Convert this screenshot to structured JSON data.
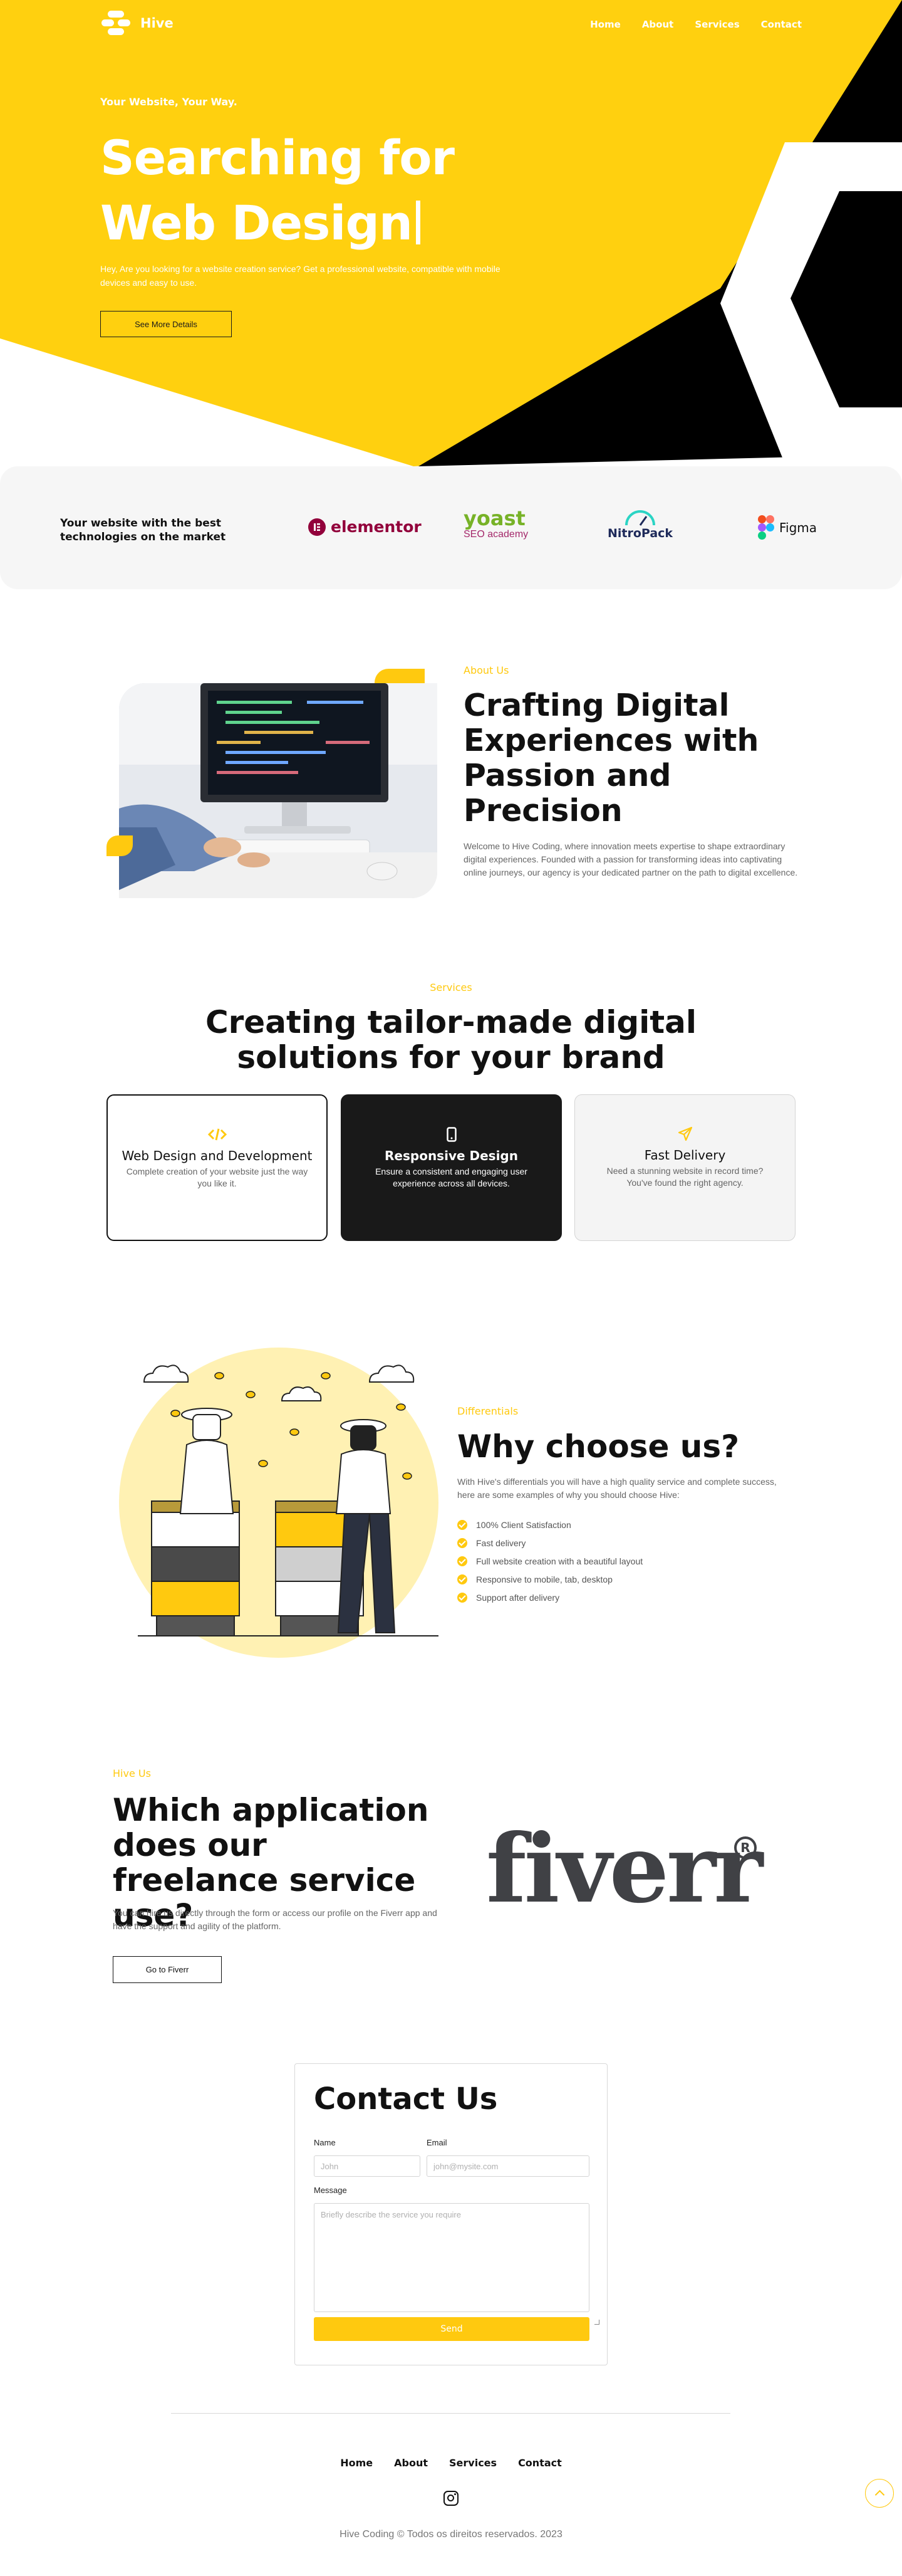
{
  "colors": {
    "accent": "#ffc90f",
    "dark": "#111111",
    "hero_black": "#000000",
    "footer_text": "#777777"
  },
  "nav": {
    "brand": "Hive",
    "logo_icon": "hive-honeycomb-icon",
    "items": [
      "Home",
      "About",
      "Services",
      "Contact"
    ]
  },
  "hero": {
    "tagline": "Your Website, Your Way.",
    "title_line1": "Searching for",
    "title_line2": "Web Design",
    "description": "Hey, Are you looking for a website creation service? Get a professional website, compatible with mobile devices and easy to use.",
    "button": "See More Details"
  },
  "tech": {
    "text": "Your website with the best technologies on the market",
    "logos": {
      "elementor": "elementor",
      "yoast_main": "yoast",
      "yoast_sub": "SEO academy",
      "nitropack": "NitroPack",
      "figma": "Figma"
    }
  },
  "about": {
    "eyebrow": "About Us",
    "title": "Crafting Digital Experiences with Passion and Precision",
    "description": "Welcome to Hive Coding, where innovation meets expertise to shape extraordinary digital experiences. Founded with a passion for transforming ideas into captivating online journeys, our agency is your dedicated partner on the path to digital excellence."
  },
  "services": {
    "eyebrow": "Services",
    "title_line1": "Creating tailor-made digital",
    "title_line2": "solutions for your brand",
    "cards": [
      {
        "icon": "code-icon",
        "title": "Web Design and Development",
        "description": "Complete creation of your website just the way you like it."
      },
      {
        "icon": "mobile-phone-icon",
        "title": "Responsive Design",
        "description": "Ensure a consistent and engaging user experience across all devices."
      },
      {
        "icon": "paper-plane-icon",
        "title": "Fast Delivery",
        "description": "Need a stunning website in record time? You've found the right agency."
      }
    ]
  },
  "differentials": {
    "eyebrow": "Differentials",
    "title": "Why choose us?",
    "description": "With Hive's differentials you will have a high quality service and complete success, here are some examples of why you should choose Hive:",
    "items": [
      "100% Client Satisfaction",
      "Fast delivery",
      "Full website creation with a beautiful layout",
      "Responsive to mobile, tab, desktop",
      "Support after delivery"
    ]
  },
  "hive_us": {
    "eyebrow": "Hive Us",
    "title": "Which application does our freelance service use?",
    "description": "You can hire us directly through the form or access our profile on the Fiverr app and have the support and agility of the platform.",
    "button": "Go to Fiverr",
    "logo_text": "fiverr",
    "logo_mark": "R"
  },
  "contact": {
    "title": "Contact Us",
    "name_label": "Name",
    "name_placeholder": "John",
    "email_label": "Email",
    "email_placeholder": "john@mysite.com",
    "message_label": "Message",
    "message_placeholder": "Briefly describe the service you require",
    "submit": "Send"
  },
  "footer": {
    "items": [
      "Home",
      "About",
      "Services",
      "Contact"
    ],
    "social_icon": "instagram-icon",
    "copyright": "Hive Coding © Todos os direitos reservados. 2023",
    "back_to_top_icon": "chevron-up-icon"
  }
}
